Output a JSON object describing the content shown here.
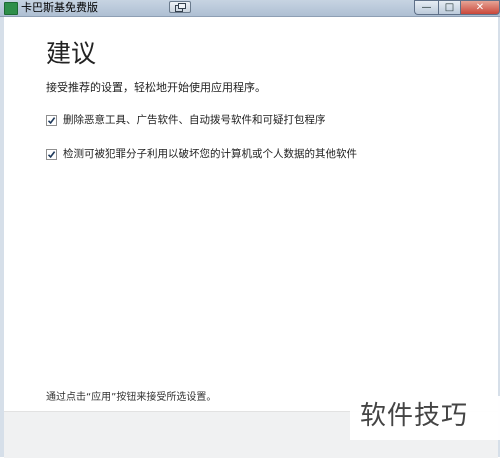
{
  "window": {
    "title": "卡巴斯基免费版",
    "controls": {
      "minimize": "—",
      "maximize": "□",
      "close": "✕"
    }
  },
  "main": {
    "heading": "建议",
    "subtitle": "接受推荐的设置，轻松地开始使用应用程序。",
    "options": [
      {
        "label": "删除恶意工具、广告软件、自动拨号软件和可疑打包程序",
        "checked": true
      },
      {
        "label": "检测可被犯罪分子利用以破坏您的计算机或个人数据的其他软件",
        "checked": true
      }
    ],
    "footer": "通过点击“应用”按钮来接受所选设置。"
  },
  "watermark": {
    "text": "软件技巧"
  },
  "colors": {
    "titlebar": "#b8c8da",
    "close_button": "#c9473a",
    "app_icon": "#2f8f4a",
    "bottom_band": "#f0f1f2"
  },
  "icons": [
    "kaspersky-app-icon",
    "restore-window-icon",
    "checkmark-icon"
  ]
}
